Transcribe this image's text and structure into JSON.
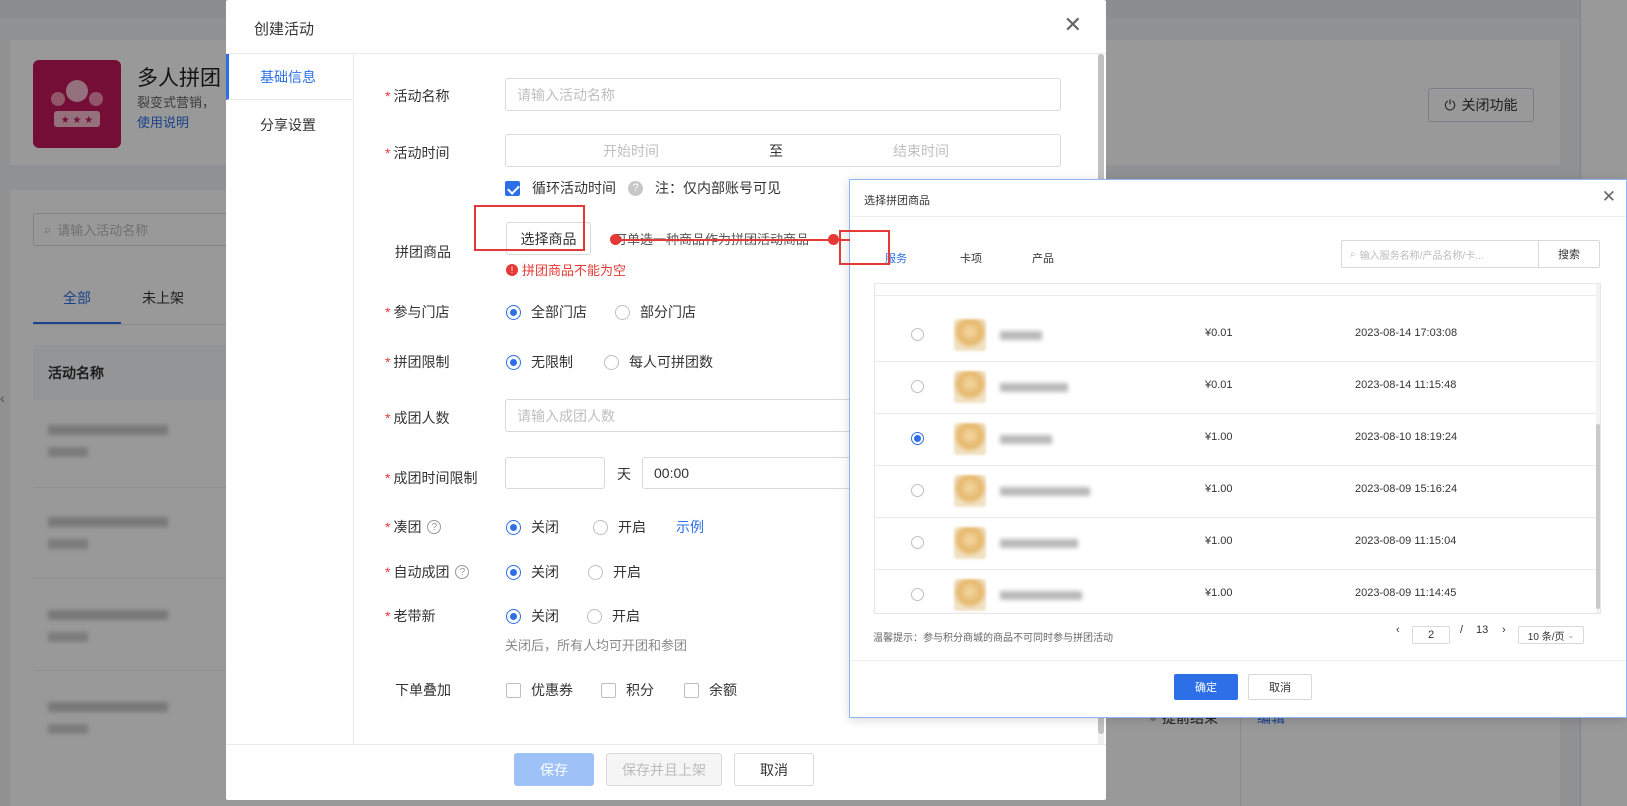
{
  "background": {
    "app_title": "多人拼团",
    "app_desc": "裂变式营销，",
    "app_help_link": "使用说明",
    "close_feature_label": "关闭功能",
    "search_placeholder": "请输入活动名称",
    "tabs": [
      "全部",
      "未上架"
    ],
    "table_header": "活动名称",
    "row_status": "提前结束",
    "row_action": "编辑"
  },
  "modal": {
    "title": "创建活动",
    "nav": [
      "基础信息",
      "分享设置"
    ],
    "fields": {
      "activity_name_label": "活动名称",
      "activity_name_placeholder": "请输入活动名称",
      "activity_time_label": "活动时间",
      "start_time_placeholder": "开始时间",
      "range_separator": "至",
      "end_time_placeholder": "结束时间",
      "loop_label": "循环活动时间",
      "loop_note": "注：仅内部账号可见",
      "product_label": "拼团商品",
      "select_product_button": "选择商品",
      "product_hint": "可单选一种商品作为拼团活动商品",
      "product_error": "拼团商品不能为空",
      "store_label": "参与门店",
      "store_options": [
        "全部门店",
        "部分门店"
      ],
      "limit_label": "拼团限制",
      "limit_options": [
        "无限制",
        "每人可拼团数"
      ],
      "group_size_label": "成团人数",
      "group_size_placeholder": "请输入成团人数",
      "time_limit_label": "成团时间限制",
      "days_unit": "天",
      "time_value": "00:00",
      "fill_group_label": "凑团",
      "fill_group_options": [
        "关闭",
        "开启"
      ],
      "example_link": "示例",
      "auto_group_label": "自动成团",
      "auto_group_options": [
        "关闭",
        "开启"
      ],
      "old_new_label": "老带新",
      "old_new_options": [
        "关闭",
        "开启"
      ],
      "old_new_hint": "关闭后，所有人均可开团和参团",
      "stack_label": "下单叠加",
      "stack_options": [
        "优惠券",
        "积分",
        "余额"
      ]
    },
    "footer": {
      "save": "保存",
      "save_publish": "保存并且上架",
      "cancel": "取消"
    }
  },
  "picker": {
    "title": "选择拼团商品",
    "tabs": [
      "服务",
      "卡项",
      "产品"
    ],
    "search_placeholder": "输入服务名称/产品名称/卡...",
    "search_button": "搜索",
    "rows": [
      {
        "price": "¥0.01",
        "time": "2023-08-14 17:03:08",
        "selected": false
      },
      {
        "price": "¥0.01",
        "time": "2023-08-14 11:15:48",
        "selected": false
      },
      {
        "price": "¥1.00",
        "time": "2023-08-10 18:19:24",
        "selected": true
      },
      {
        "price": "¥1.00",
        "time": "2023-08-09 15:16:24",
        "selected": false
      },
      {
        "price": "¥1.00",
        "time": "2023-08-09 11:15:04",
        "selected": false
      },
      {
        "price": "¥1.00",
        "time": "2023-08-09 11:14:45",
        "selected": false
      }
    ],
    "tip": "温馨提示：参与积分商城的商品不可同时参与拼团活动",
    "page_current": "2",
    "page_sep": "/",
    "page_total": "13",
    "page_size": "10 条/页",
    "ok": "确定",
    "cancel": "取消"
  },
  "colors": {
    "primary": "#2d6fe6",
    "error": "#e53935",
    "app_icon": "#c2185b"
  }
}
